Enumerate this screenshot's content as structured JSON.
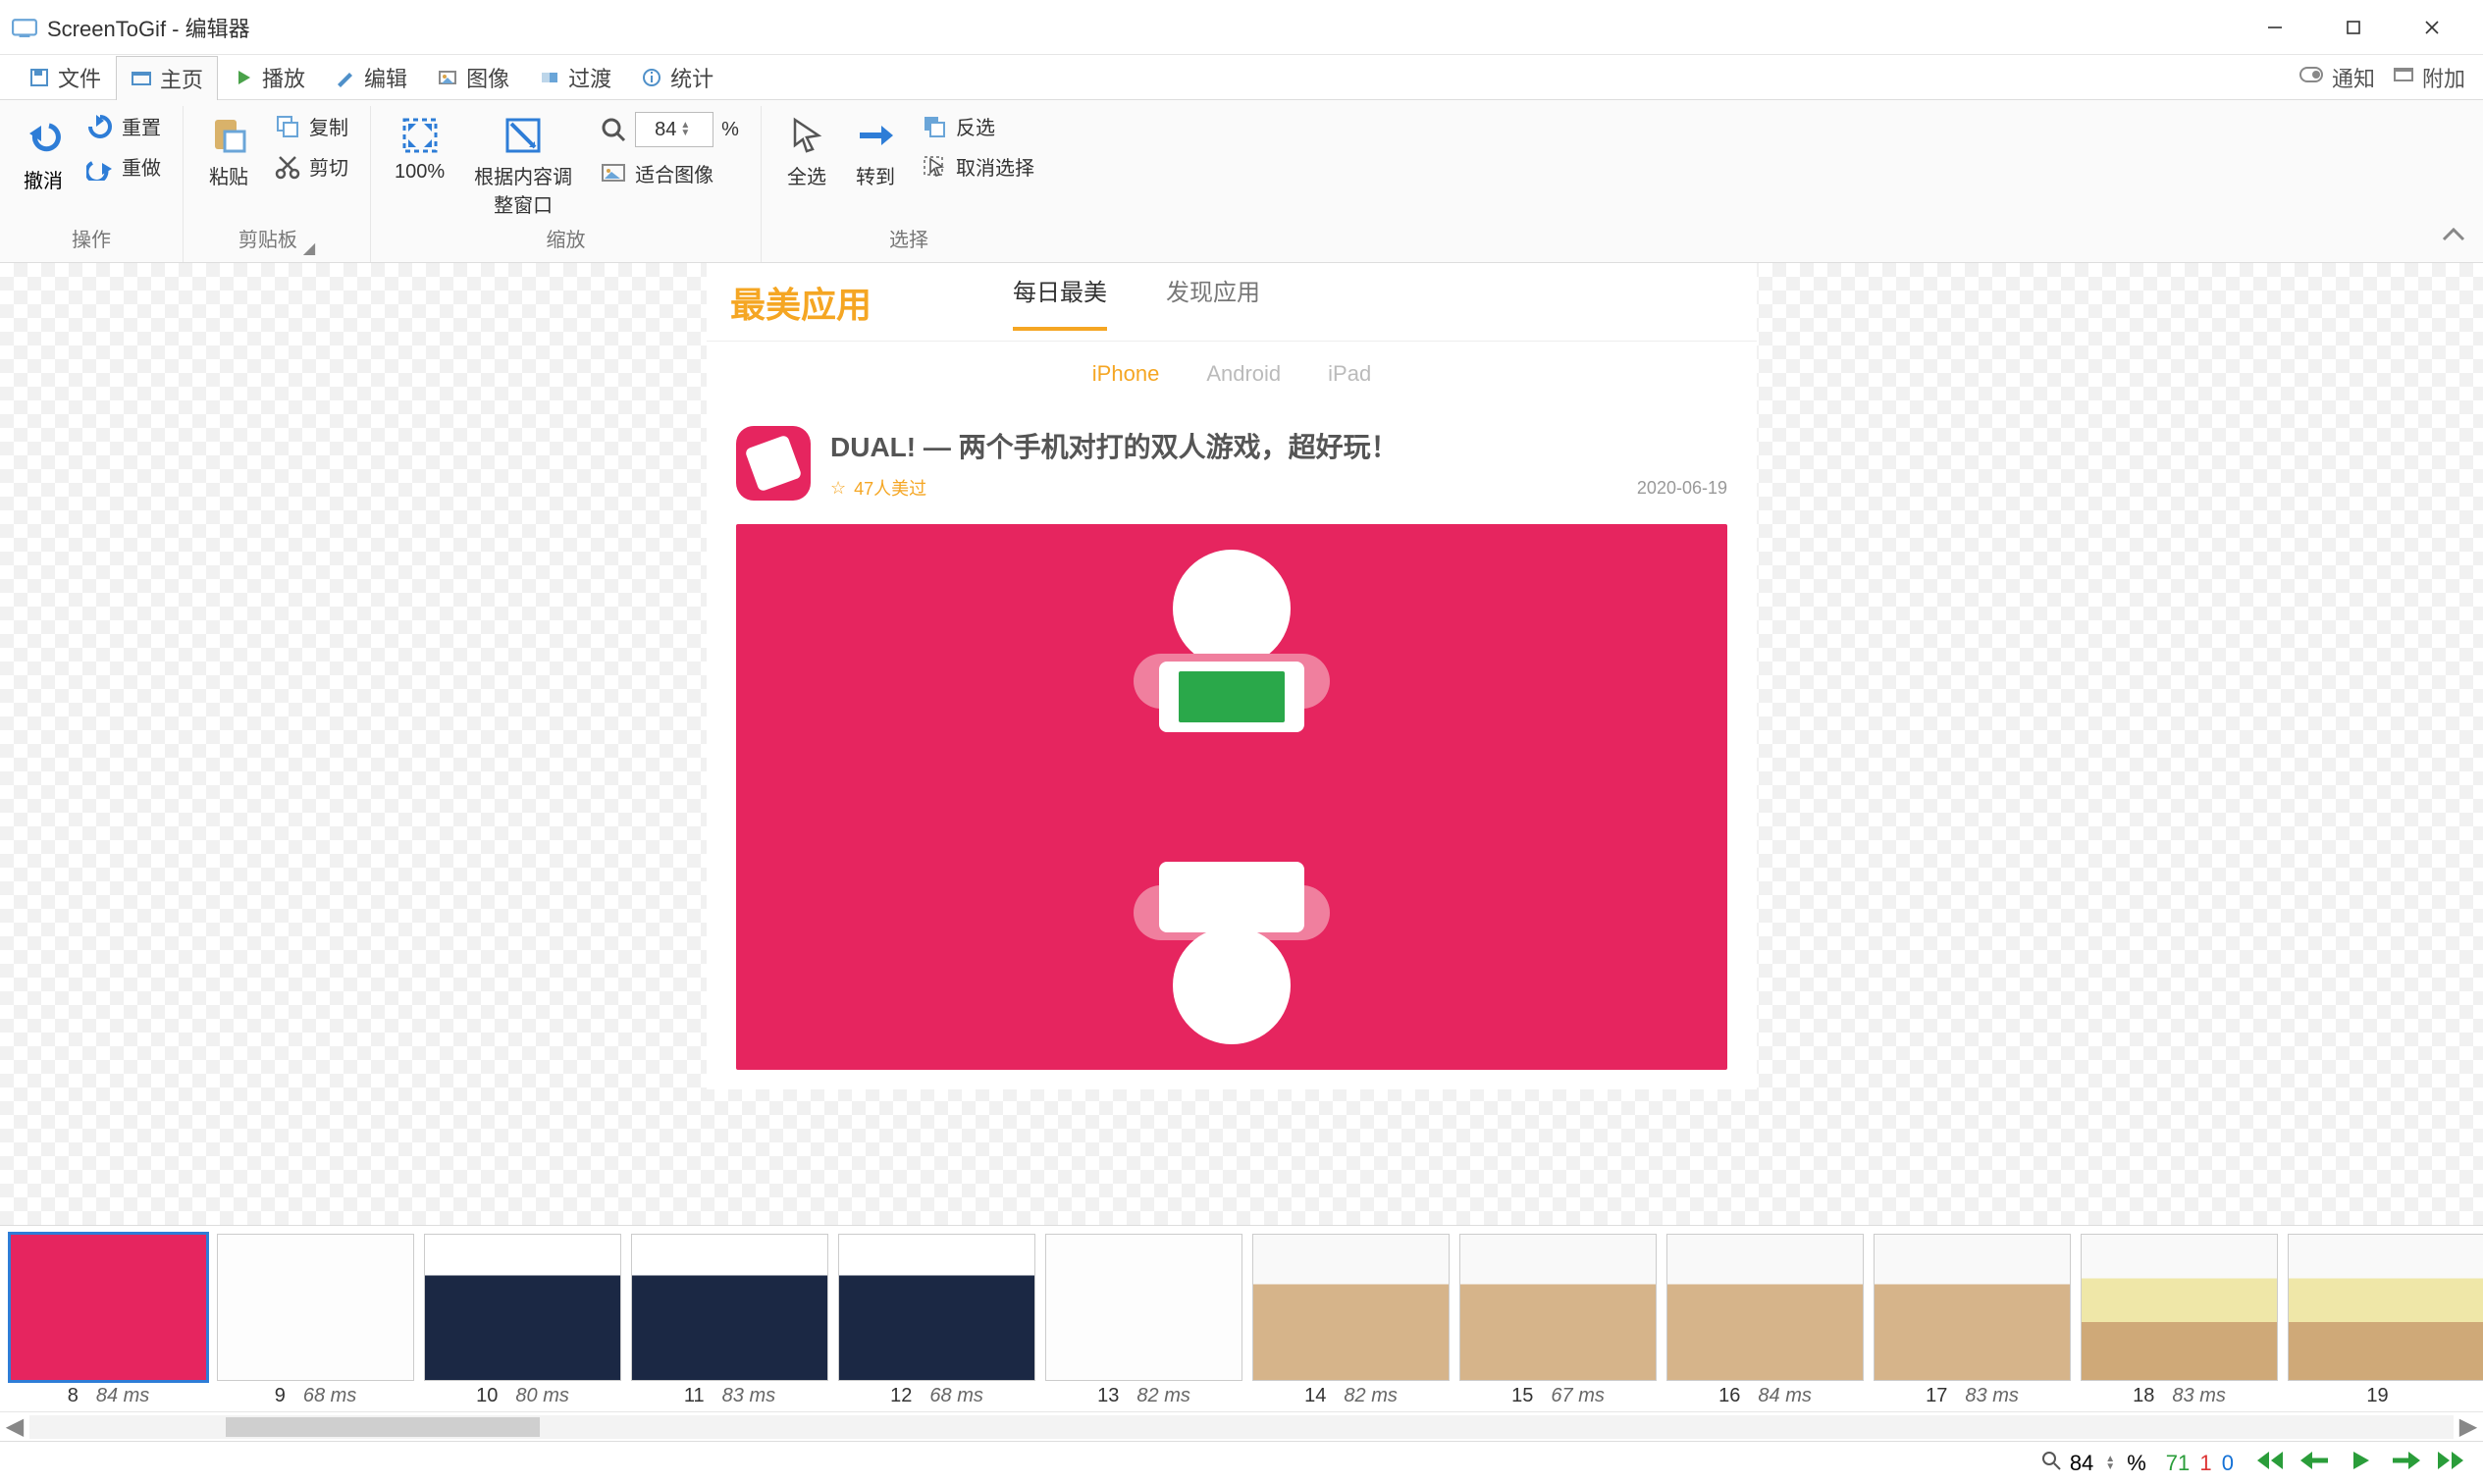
{
  "window": {
    "title": "ScreenToGif - 编辑器"
  },
  "menu": {
    "tabs": [
      {
        "label": "文件"
      },
      {
        "label": "主页"
      },
      {
        "label": "播放"
      },
      {
        "label": "编辑"
      },
      {
        "label": "图像"
      },
      {
        "label": "过渡"
      },
      {
        "label": "统计"
      }
    ],
    "active_index": 1,
    "right": {
      "notify": "通知",
      "attach": "附加"
    }
  },
  "ribbon": {
    "actions": {
      "undo": "撤消",
      "reset": "重置",
      "redo": "重做",
      "group": "操作"
    },
    "clipboard": {
      "paste": "粘贴",
      "copy": "复制",
      "cut": "剪切",
      "group": "剪贴板"
    },
    "zoom": {
      "hundred": "100%",
      "fit_content": "根据内容调整窗口",
      "fit_image": "适合图像",
      "value": "84",
      "percent": "%",
      "group": "缩放"
    },
    "selection": {
      "select_all": "全选",
      "go_to": "转到",
      "invert": "反选",
      "deselect": "取消选择",
      "group": "选择"
    }
  },
  "content": {
    "brand": "最美应用",
    "tabs": {
      "daily": "每日最美",
      "discover": "发现应用"
    },
    "platforms": {
      "iphone": "iPhone",
      "android": "Android",
      "ipad": "iPad"
    },
    "article": {
      "title": "DUAL! — 两个手机对打的双人游戏，超好玩！",
      "likes": "47人美过",
      "date": "2020-06-19"
    }
  },
  "frames": [
    {
      "n": "8",
      "ms": "84 ms",
      "variant": "a",
      "selected": true
    },
    {
      "n": "9",
      "ms": "68 ms",
      "variant": "c"
    },
    {
      "n": "10",
      "ms": "80 ms",
      "variant": "b"
    },
    {
      "n": "11",
      "ms": "83 ms",
      "variant": "b"
    },
    {
      "n": "12",
      "ms": "68 ms",
      "variant": "b"
    },
    {
      "n": "13",
      "ms": "82 ms",
      "variant": "c"
    },
    {
      "n": "14",
      "ms": "82 ms",
      "variant": "d"
    },
    {
      "n": "15",
      "ms": "67 ms",
      "variant": "d"
    },
    {
      "n": "16",
      "ms": "84 ms",
      "variant": "d"
    },
    {
      "n": "17",
      "ms": "83 ms",
      "variant": "d"
    },
    {
      "n": "18",
      "ms": "83 ms",
      "variant": "e"
    },
    {
      "n": "19",
      "ms": "",
      "variant": "e"
    }
  ],
  "status": {
    "zoom": "84",
    "percent": "%",
    "counts": {
      "total": "71",
      "selected": "1",
      "other": "0"
    }
  }
}
